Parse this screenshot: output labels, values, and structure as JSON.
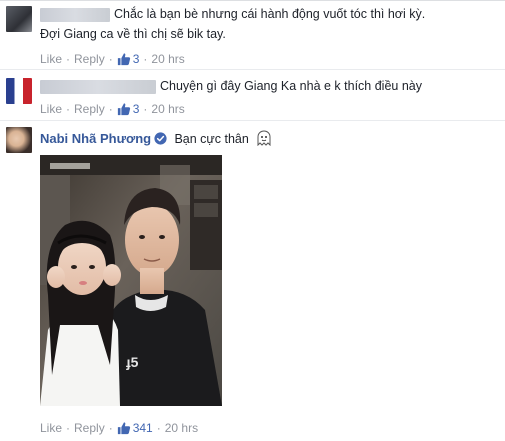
{
  "comments": [
    {
      "text_line1": "Chắc là bạn bè nhưng cái hành động vuốt tóc thì hơi kỳ.",
      "text_line2": "Đợi Giang ca về thì chị sẽ bik tay.",
      "like_label": "Like",
      "reply_label": "Reply",
      "like_count": "3",
      "time": "20 hrs"
    },
    {
      "text_line1": "Chuyện gì đây Giang Ka nhà e k thích điều này",
      "like_label": "Like",
      "reply_label": "Reply",
      "like_count": "3",
      "time": "20 hrs"
    },
    {
      "author": "Nabi Nhã Phương",
      "text_line1": "Bạn cực thân",
      "like_label": "Like",
      "reply_label": "Reply",
      "like_count": "341",
      "time": "20 hrs"
    }
  ],
  "colors": {
    "link": "#365899",
    "meta": "#90949c",
    "like_blue": "#4267b2",
    "verified": "#4267b2"
  }
}
